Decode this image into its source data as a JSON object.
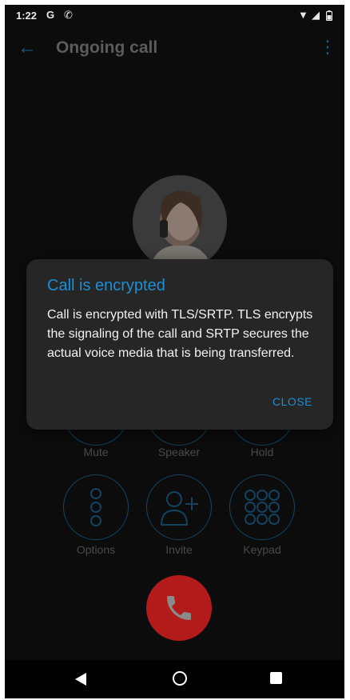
{
  "status_bar": {
    "time": "1:22",
    "icons": [
      "google-icon",
      "wifi-call-icon",
      "wifi-icon",
      "signal-icon",
      "battery-icon"
    ]
  },
  "app_bar": {
    "title": "Ongoing call"
  },
  "call_controls": {
    "row1": [
      {
        "label": "Mute",
        "icon": "mic-icon"
      },
      {
        "label": "Speaker",
        "icon": "speaker-icon"
      },
      {
        "label": "Hold",
        "icon": "pause-icon"
      }
    ],
    "row2": [
      {
        "label": "Options",
        "icon": "options-icon"
      },
      {
        "label": "Invite",
        "icon": "add-person-icon"
      },
      {
        "label": "Keypad",
        "icon": "keypad-icon"
      }
    ]
  },
  "dialog": {
    "title": "Call is encrypted",
    "body": "Call is encrypted with TLS/SRTP. TLS encrypts the signaling of the call and SRTP secures the actual voice media that is being transferred.",
    "close_label": "CLOSE"
  },
  "colors": {
    "accent": "#1b8fd6",
    "end_call": "#b31b1b",
    "dialog_bg": "#262626"
  }
}
